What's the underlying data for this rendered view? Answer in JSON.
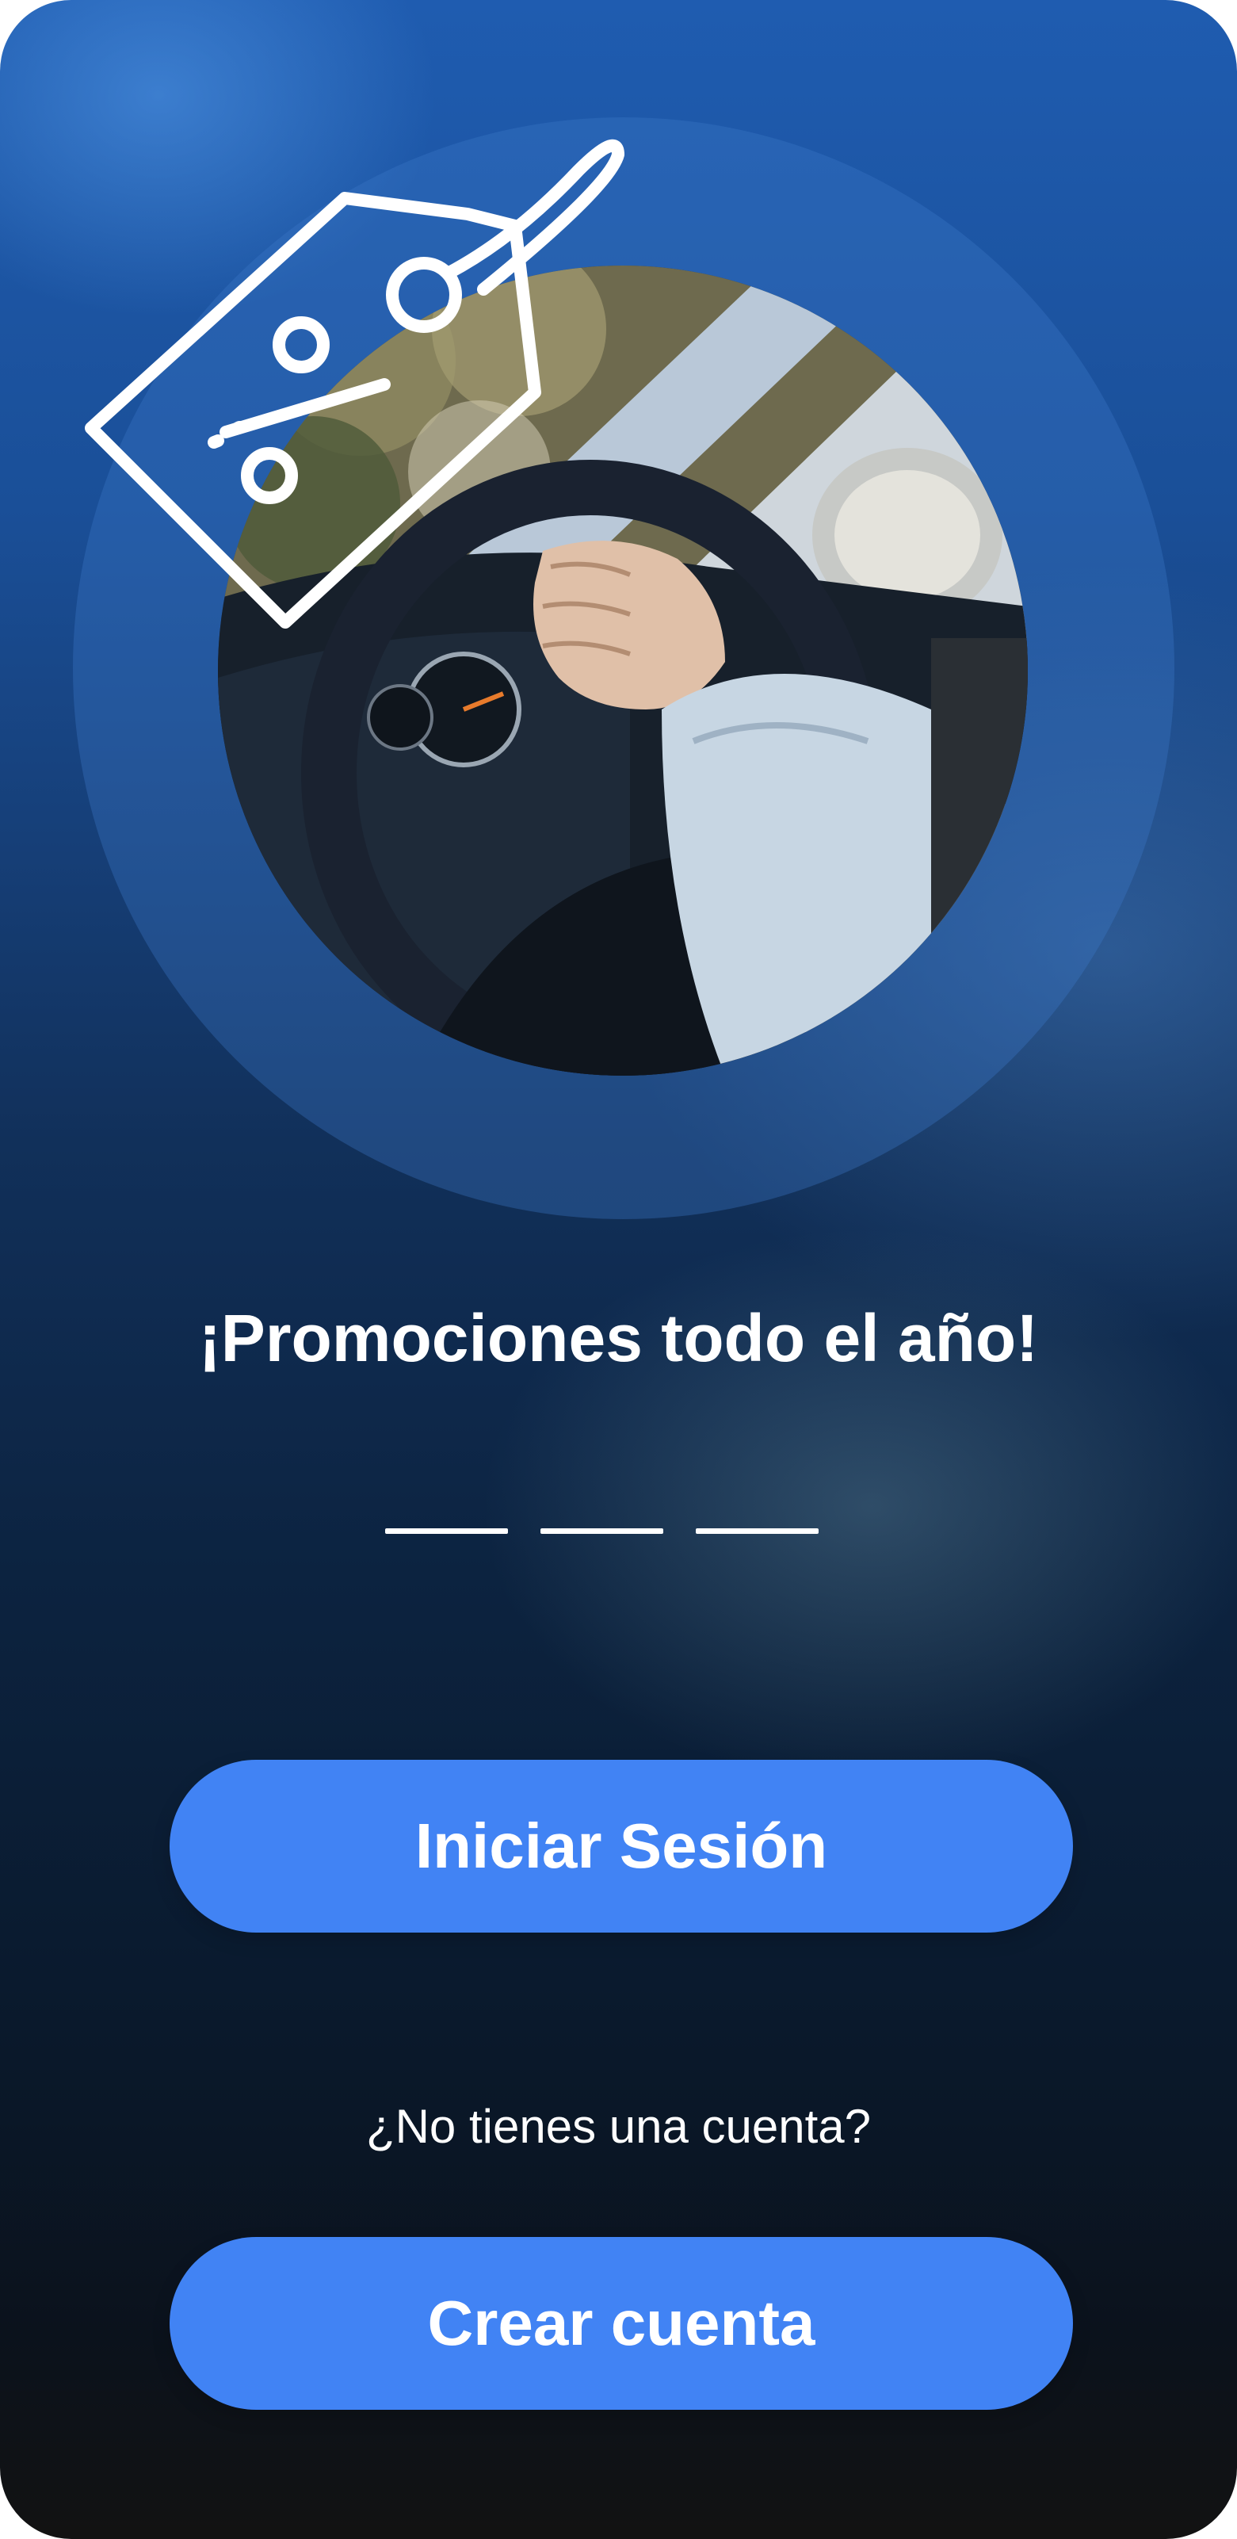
{
  "onboarding": {
    "headline": "¡Promociones todo el año!",
    "page_indicator": {
      "total": 3
    },
    "login_button_label": "Iniciar Sesión",
    "no_account_prompt": "¿No tienes una cuenta?",
    "create_account_button_label": "Crear cuenta"
  },
  "colors": {
    "button": "#4183f4",
    "text": "#ffffff",
    "background_top": "#1f5cb0",
    "background_bottom": "#121212"
  },
  "icons": {
    "tag": "price-tag-percent-icon",
    "photo": "driver-steering-wheel-photo"
  }
}
